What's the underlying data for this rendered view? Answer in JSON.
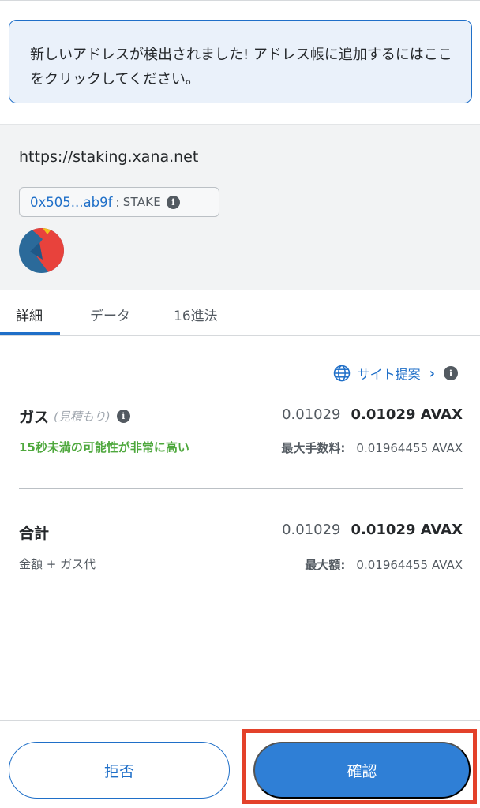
{
  "notice": {
    "text": "新しいアドレスが検出されました! アドレス帳に追加するにはここをクリックしてください。"
  },
  "origin": {
    "url": "https://staking.xana.net",
    "contract_address": "0x505...ab9f",
    "separator": ":",
    "method": "STAKE",
    "info_glyph": "i",
    "avatar_icon": "jazzicon-avatar"
  },
  "tabs": [
    {
      "label": "詳細",
      "active": true
    },
    {
      "label": "データ",
      "active": false
    },
    {
      "label": "16進法",
      "active": false
    }
  ],
  "site_suggestion": {
    "label": "サイト提案",
    "chevron": "›",
    "icon": "globe-icon"
  },
  "gas": {
    "label": "ガス",
    "sub_label": "(見積もり)",
    "fiat_amount": "0.01029",
    "amount": "0.01029 AVAX",
    "speed_text": "15秒未満の可能性が非常に高い",
    "max_fee_label": "最大手数料:",
    "max_fee_value": "0.01964455 AVAX"
  },
  "total": {
    "label": "合計",
    "fiat_amount": "0.01029",
    "amount": "0.01029 AVAX",
    "sub_label": "金額 + ガス代",
    "max_label": "最大額:",
    "max_value": "0.01964455 AVAX"
  },
  "buttons": {
    "reject": "拒否",
    "confirm": "確認"
  },
  "colors": {
    "primary": "#1f6fc8",
    "confirm_fill": "#2f7fd6",
    "success": "#4ea83d",
    "highlight": "#e3412a"
  }
}
